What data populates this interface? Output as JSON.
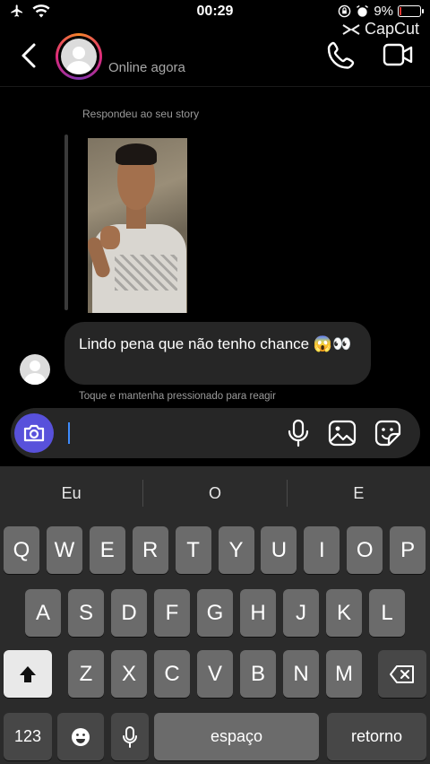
{
  "status_bar": {
    "time": "00:29",
    "battery": "9%",
    "battery_level": 0.09,
    "watermark": "CapCut",
    "icons": [
      "airplane-icon",
      "wifi-icon",
      "orientation-lock-icon",
      "alarm-icon",
      "battery-charging-icon"
    ]
  },
  "header": {
    "status": "Online agora",
    "icons": [
      "back-icon",
      "phone-icon",
      "video-icon"
    ]
  },
  "chat": {
    "story_caption": "Respondeu ao seu story",
    "message_text": "Lindo pena que não tenho chance 😱👀",
    "react_hint": "Toque e mantenha pressionado para reagir"
  },
  "composer": {
    "icons": [
      "camera-icon",
      "microphone-icon",
      "gallery-icon",
      "sticker-icon"
    ],
    "accent": "#5851db"
  },
  "keyboard": {
    "suggestions": [
      "Eu",
      "O",
      "E"
    ],
    "row1": [
      "Q",
      "W",
      "E",
      "R",
      "T",
      "Y",
      "U",
      "I",
      "O",
      "P"
    ],
    "row2": [
      "A",
      "S",
      "D",
      "F",
      "G",
      "H",
      "J",
      "K",
      "L"
    ],
    "row3": [
      "Z",
      "X",
      "C",
      "V",
      "B",
      "N",
      "M"
    ],
    "numbers_key": "123",
    "space_key": "espaço",
    "return_key": "retorno"
  }
}
